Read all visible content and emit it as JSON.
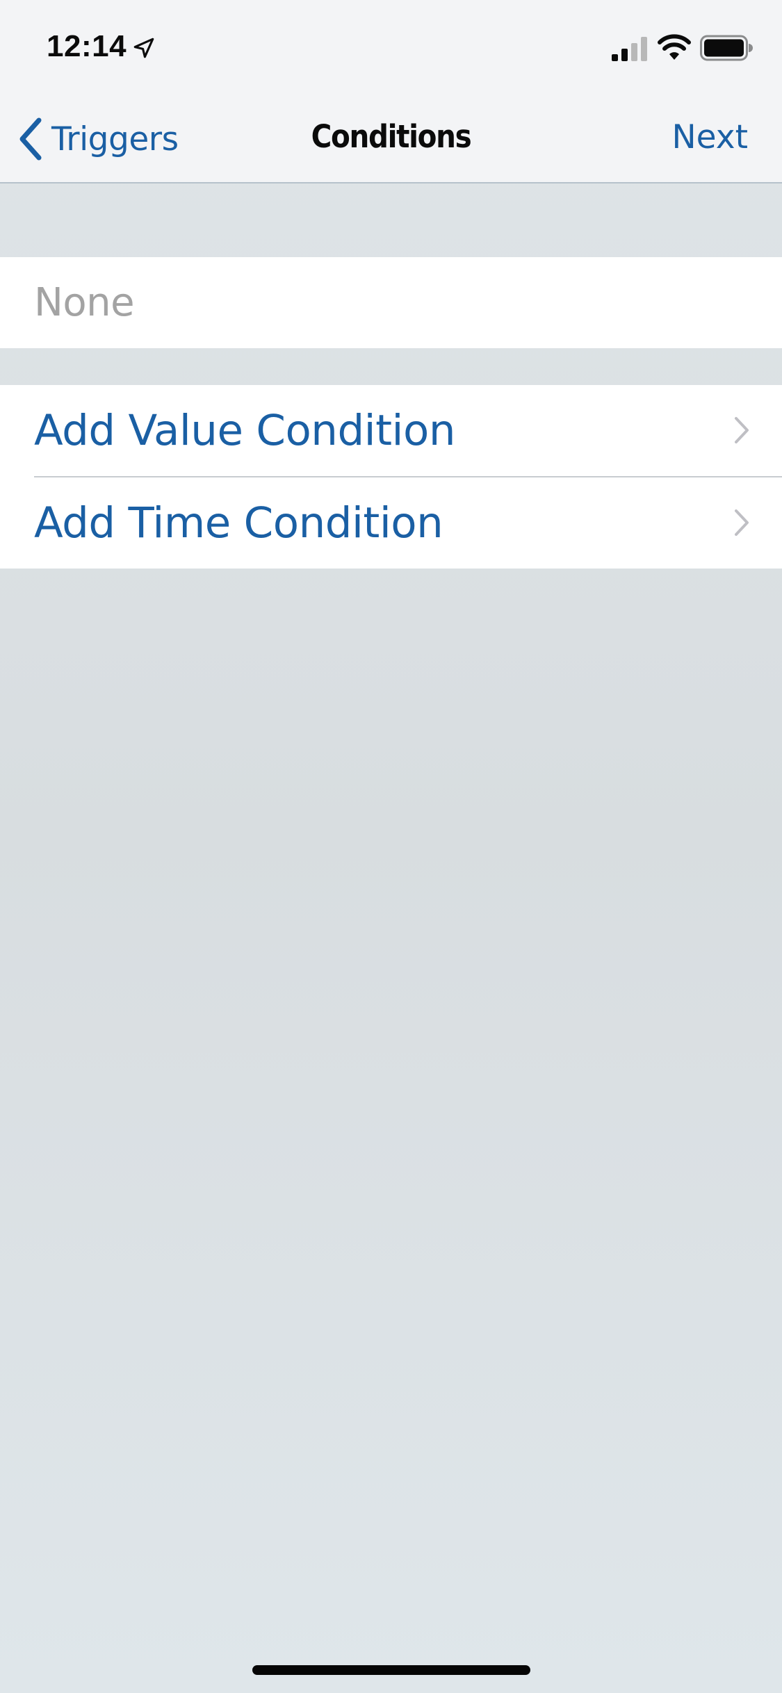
{
  "status_bar": {
    "time": "12:14",
    "icons": [
      "location-arrow-icon",
      "cellular-signal-icon",
      "wifi-icon",
      "battery-icon"
    ]
  },
  "nav": {
    "back_label": "Triggers",
    "title": "Conditions",
    "next_label": "Next"
  },
  "conditions": {
    "empty_text": "None"
  },
  "actions": {
    "items": [
      {
        "label": "Add Value Condition"
      },
      {
        "label": "Add Time Condition"
      }
    ]
  },
  "colors": {
    "accent": "#1a5fa4",
    "background": "#dfe5e8",
    "placeholder": "#a3a3a3"
  }
}
